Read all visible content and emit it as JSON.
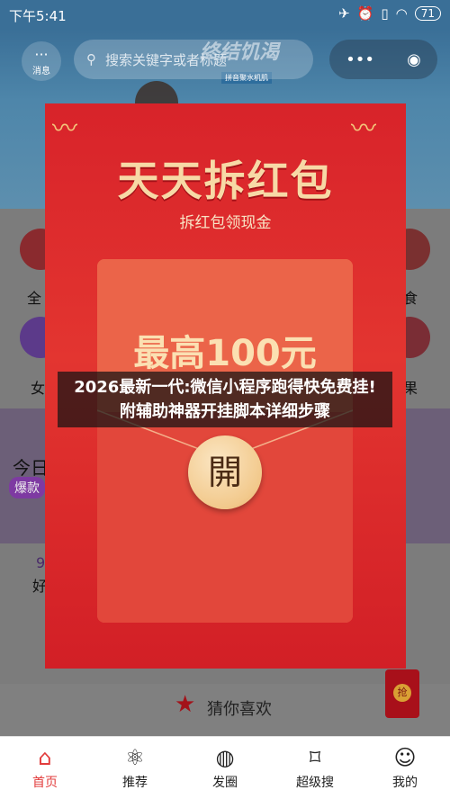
{
  "status_bar": {
    "time": "下午5:41",
    "battery": "71"
  },
  "header": {
    "message_label": "消息",
    "search_placeholder": "搜索关键字或者标题",
    "banner_title": "终结饥渴",
    "banner_sub": "拼音聚水机肌"
  },
  "background": {
    "categories": [
      {
        "label": "全",
        "color": "#8a2a2e"
      },
      {
        "label": "食",
        "color": "#7a3030"
      },
      {
        "label": "女",
        "color": "#5c3a8a"
      },
      {
        "label": "果",
        "color": "#7a2d35"
      }
    ],
    "today_label": "今日",
    "hot_badge": "爆款",
    "nine_label": "9",
    "hao_label": "好",
    "guess_label": "猜你喜欢",
    "red_packet_badge": "抢"
  },
  "modal": {
    "title": "天天拆红包",
    "subtitle": "拆红包领现金",
    "max_text": "最高100元",
    "open_label": "開"
  },
  "caption": "2026最新一代:微信小程序跑得快免费挂!附辅助神器开挂脚本详细步骤",
  "tabbar": [
    {
      "label": "首页",
      "icon": "home-icon",
      "active": true
    },
    {
      "label": "推荐",
      "icon": "atom-icon",
      "active": false
    },
    {
      "label": "发圈",
      "icon": "planet-icon",
      "active": false
    },
    {
      "label": "超级搜",
      "icon": "tag-icon",
      "active": false
    },
    {
      "label": "我的",
      "icon": "user-icon",
      "active": false
    }
  ],
  "colors": {
    "accent": "#e23c3c",
    "modal_red": "#d8232a",
    "gold": "#f7d9a6"
  }
}
